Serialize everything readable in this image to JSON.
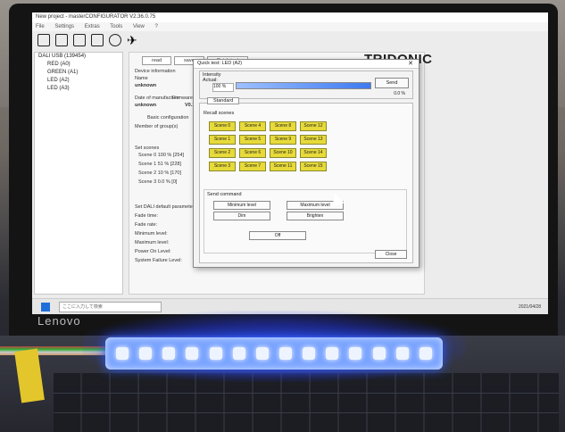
{
  "app": {
    "title": "New project - masterCONFIGURATOR V2.36.0.75",
    "menu": [
      "File",
      "Settings",
      "Extras",
      "Tools",
      "View",
      "?"
    ],
    "brand_logo": "TRIDONIC"
  },
  "tree": {
    "root": "DALI USB (139454)",
    "items": [
      "RED (A0)",
      "GREEN (A1)",
      "LED (A2)",
      "LED (A3)"
    ]
  },
  "device_panel": {
    "tabs": [
      "read",
      "save",
      "Quick test"
    ],
    "info_title": "Device information",
    "name_label": "Name",
    "name_value": "unknown",
    "manufacture_label": "Date of manufacture",
    "manufacture_value": "unknown",
    "firmware_label": "Firmware ve",
    "firmware_value": "V0.1",
    "sub_tabs": [
      "Basic configuration"
    ],
    "member_groups": "Member of group(s)",
    "set_scenes": "Set scenes",
    "scene_rows": [
      "Scene 0  100 % [254]",
      "Scene 1  51 % [228]",
      "Scene 2  10 % [170]",
      "Scene 3  0.0 % [0]"
    ],
    "defaults_title": "Set DALI default parameters",
    "defaults": [
      "Fade time:",
      "Fade rate:",
      "Minimum level:",
      "Maximum level:",
      "Power On Level:",
      "System Failure Level:"
    ]
  },
  "dialog": {
    "title": "Quick test: LED (A2)",
    "intensity_label": "Intensity",
    "actual_label": "Actual:",
    "actual_value": "100 %",
    "send_label": "Send",
    "percent": "0.0 %",
    "intensity_fraction": 1.0,
    "standard_tab": "Standard",
    "recall_label": "Recall scenes",
    "scenes": [
      "Scene 0",
      "Scene 4",
      "Scene 8",
      "Scene 12",
      "Scene 1",
      "Scene 5",
      "Scene 9",
      "Scene 13",
      "Scene 2",
      "Scene 6",
      "Scene 10",
      "Scene 14",
      "Scene 3",
      "Scene 7",
      "Scene 11",
      "Scene 15"
    ],
    "send_command_label": "Send command",
    "min_level": "Minimum level",
    "max_level": "Maximum level",
    "dim": "Dim",
    "brighten": "Brighten",
    "off": "Off",
    "close": "Close"
  },
  "taskbar": {
    "search_placeholder": "ここに入力して検索",
    "clock": "2021/04/28"
  },
  "laptop_brand": "Lenovo"
}
